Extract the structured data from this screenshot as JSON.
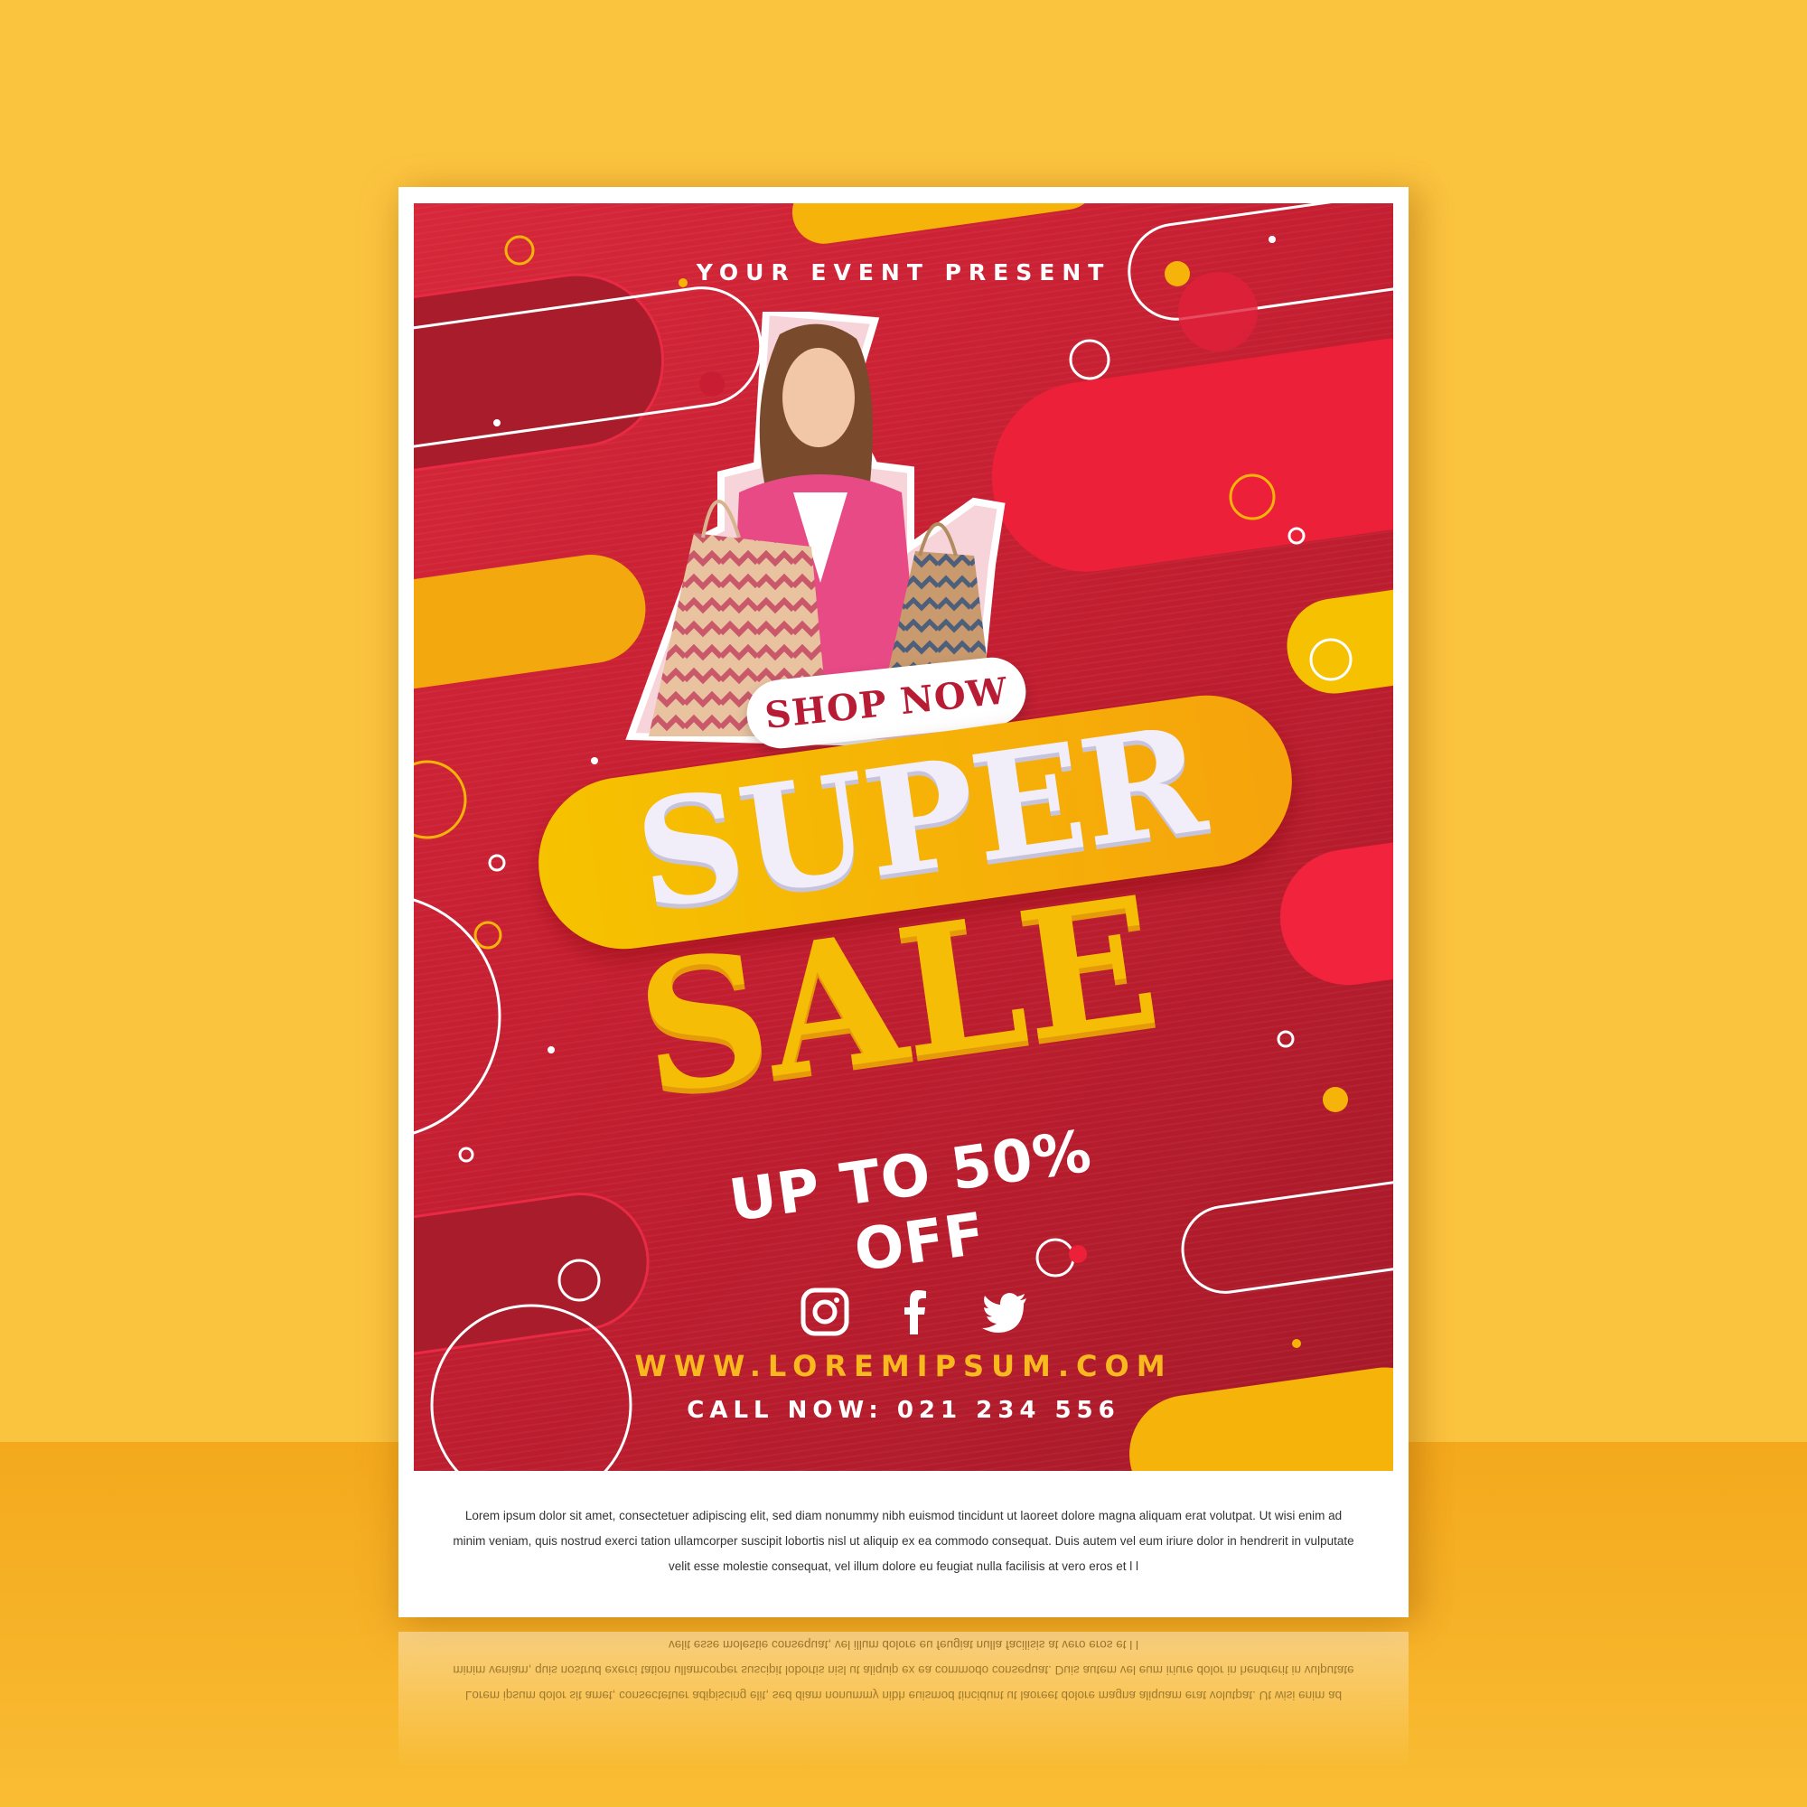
{
  "poster": {
    "event_title": "YOUR EVENT PRESENT",
    "shop_now": "SHOP NOW",
    "headline_1": "SUPER",
    "headline_2": "SALE",
    "discount": "UP TO 50% OFF",
    "social_icons": [
      "instagram-icon",
      "facebook-icon",
      "twitter-icon"
    ],
    "website": "WWW.LOREMIPSUM.COM",
    "phone": "CALL NOW: 021 234 556",
    "footer": "Lorem ipsum dolor sit amet, consectetuer adipiscing elit, sed diam nonummy nibh euismod tincidunt ut laoreet dolore magna aliquam erat volutpat. Ut wisi enim ad minim veniam, quis nostrud exerci tation ullamcorper suscipit lobortis nisl ut aliquip ex ea commodo consequat. Duis autem vel eum iriure dolor in hendrerit in vulputate velit esse molestie consequat, vel illum dolore eu feugiat nulla facilisis at vero eros et l l"
  },
  "colors": {
    "background": "#FBC43F",
    "poster_red": "#C61F32",
    "accent_yellow": "#F6BD06",
    "white": "#FFFFFF"
  }
}
